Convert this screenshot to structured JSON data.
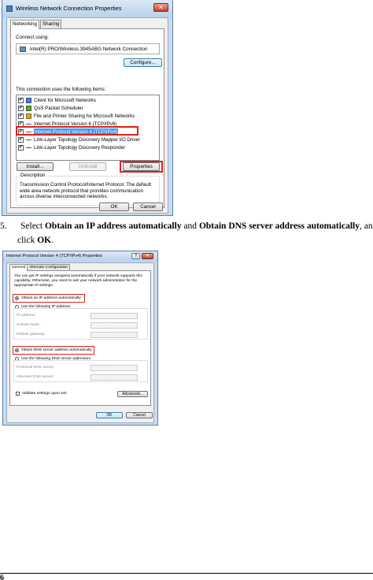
{
  "dialog1": {
    "title": "Wireless Network Connection Properties",
    "close_label": "✕",
    "tabs": [
      {
        "label": "Networking"
      },
      {
        "label": "Sharing"
      }
    ],
    "connect_using_label": "Connect using:",
    "adapter_name": "Intel(R) PRO/Wireless 3945ABG Network Connection",
    "configure_button": "Configure...",
    "items_label": "This connection uses the following items:",
    "items": [
      {
        "label": "Client for Microsoft Networks",
        "checked": true
      },
      {
        "label": "QoS Packet Scheduler",
        "checked": true
      },
      {
        "label": "File and Printer Sharing for Microsoft Networks",
        "checked": true
      },
      {
        "label": "Internet Protocol Version 6 (TCP/IPv6)",
        "checked": true
      },
      {
        "label": "Internet Protocol Version 4 (TCP/IPv4)",
        "checked": true,
        "selected": true
      },
      {
        "label": "Link-Layer Topology Discovery Mapper I/O Driver",
        "checked": true
      },
      {
        "label": "Link-Layer Topology Discovery Responder",
        "checked": true
      }
    ],
    "install_button": "Install...",
    "uninstall_button": "Uninstall",
    "properties_button": "Properties",
    "description_label": "Description",
    "description_text": "Transmission Control Protocol/Internet Protocol. The default wide area network protocol that provides communication across diverse interconnected networks.",
    "ok_button": "OK",
    "cancel_button": "Cancel",
    "check_mark": "✔"
  },
  "instruction": {
    "number": "5.",
    "text_select": "Select ",
    "bold_1": "Obtain an IP address automatically",
    "text_and": " and ",
    "bold_2": "Obtain DNS server address automatically",
    "text_end": ", and",
    "text_click": "click ",
    "bold_ok": "OK",
    "text_period": "."
  },
  "dialog2": {
    "title": "Internet Protocol Version 4 (TCP/IPv4) Properties",
    "help_label": "?",
    "close_label": "✕",
    "tabs": [
      {
        "label": "General"
      },
      {
        "label": "Alternate Configuration"
      }
    ],
    "intro_text": "You can get IP settings assigned automatically if your network supports this capability. Otherwise, you need to ask your network administrator for the appropriate IP settings.",
    "obtain_ip_auto": "Obtain an IP address automatically",
    "use_following_ip": "Use the following IP address:",
    "ip_address_label": "IP address:",
    "subnet_mask_label": "Subnet mask:",
    "default_gateway_label": "Default gateway:",
    "obtain_dns_auto": "Obtain DNS server address automatically",
    "use_following_dns": "Use the following DNS server addresses:",
    "preferred_dns_label": "Preferred DNS server:",
    "alternate_dns_label": "Alternate DNS server:",
    "validate_label": "Validate settings upon exit",
    "advanced_button": "Advanced...",
    "ok_button": "OK",
    "cancel_button": "Cancel",
    "ip_dots": ".       .       ."
  },
  "footer": {
    "page_number": "6"
  },
  "colors": {
    "highlight_red": "#e0201c",
    "selection_blue": "#3399ff",
    "title_bar": "#c9dcef"
  }
}
